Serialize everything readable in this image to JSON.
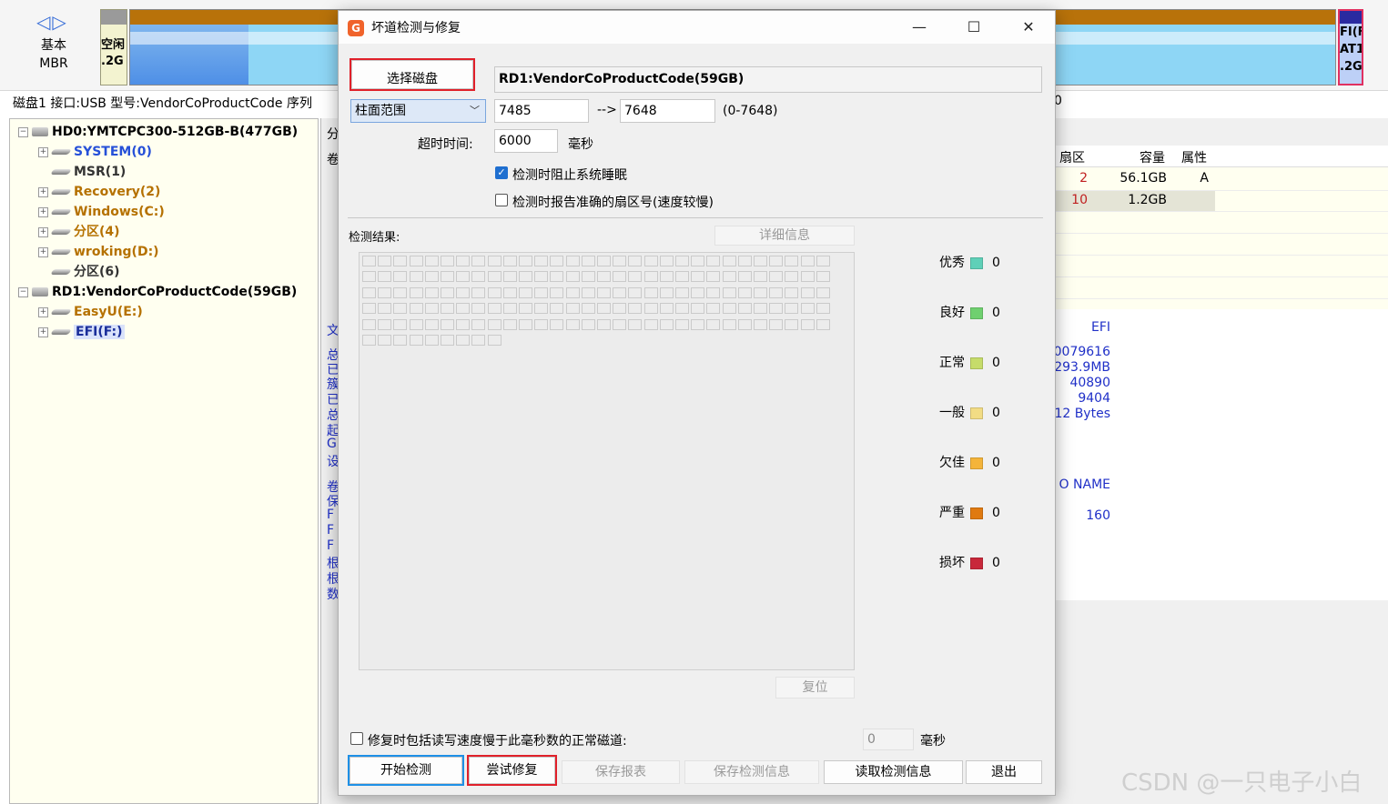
{
  "background": {
    "nav_arrows": "◁▷",
    "disk_type_line1": "基本",
    "disk_type_line2": "MBR",
    "free_block_line1": "空闲",
    "free_block_line2": ".2G",
    "efi_block_line1": "FI(F",
    "efi_block_line2": "AT1",
    "efi_block_line3": ".2G",
    "disk_info_line": "磁盘1 接口:USB  型号:VendorCoProductCode  序列",
    "disk_info_tail": "0",
    "tree": [
      {
        "label": "HD0:YMTCPC300-512GB-B(477GB)",
        "kind": "disk",
        "color": "disk"
      },
      {
        "label": "SYSTEM(0)",
        "kind": "part",
        "color": "blue",
        "expand": "+"
      },
      {
        "label": "MSR(1)",
        "kind": "part",
        "color": "gray",
        "expand": ""
      },
      {
        "label": "Recovery(2)",
        "kind": "part",
        "color": "orange",
        "expand": "+"
      },
      {
        "label": "Windows(C:)",
        "kind": "part",
        "color": "orange",
        "expand": "+"
      },
      {
        "label": "分区(4)",
        "kind": "part",
        "color": "orange",
        "expand": "+"
      },
      {
        "label": "wroking(D:)",
        "kind": "part",
        "color": "orange",
        "expand": "+"
      },
      {
        "label": "分区(6)",
        "kind": "part",
        "color": "gray",
        "expand": ""
      },
      {
        "label": "RD1:VendorCoProductCode(59GB)",
        "kind": "disk",
        "color": "disk"
      },
      {
        "label": "EasyU(E:)",
        "kind": "part",
        "color": "orange",
        "expand": "+"
      },
      {
        "label": "EFI(F:)",
        "kind": "part",
        "color": "sel",
        "expand": "+"
      }
    ],
    "right_partial_labels": [
      "分",
      "卷",
      "文",
      "总",
      "已",
      "簇",
      "已",
      "总",
      "起",
      "G",
      "设",
      "卷",
      "保",
      "F",
      "F",
      "F",
      "根",
      "根",
      "数"
    ],
    "table_headers": {
      "sector": "扇区",
      "capacity": "容量",
      "attr": "属性"
    },
    "table_rows": [
      {
        "sector": "2",
        "capacity": "56.1GB",
        "attr": "A"
      },
      {
        "sector": "10",
        "capacity": "1.2GB",
        "attr": ""
      }
    ],
    "info_values": [
      "EFI",
      "0079616",
      "293.9MB",
      "40890",
      "9404",
      "12 Bytes",
      "O NAME",
      "160"
    ],
    "watermark": "CSDN @一只电子小白"
  },
  "dialog": {
    "title": "坏道检测与修复",
    "app_icon": "G",
    "select_disk_label": "选择磁盘",
    "disk_name": "RD1:VendorCoProductCode(59GB)",
    "range_mode": "柱面范围",
    "range_start": "7485",
    "range_arrow": "-->",
    "range_end": "7648",
    "range_hint": "(0-7648)",
    "timeout_label": "超时时间:",
    "timeout_value": "6000",
    "timeout_unit": "毫秒",
    "opt_prevent_sleep": "检测时阻止系统睡眠",
    "opt_prevent_sleep_checked": true,
    "opt_report_sector": "检测时报告准确的扇区号(速度较慢)",
    "opt_report_sector_checked": false,
    "results_label": "检测结果:",
    "detail_button": "详细信息",
    "reset_button": "复位",
    "legend": [
      {
        "label": "优秀",
        "color": "#5fd0b8",
        "count": "0"
      },
      {
        "label": "良好",
        "color": "#6fd06f",
        "count": "0"
      },
      {
        "label": "正常",
        "color": "#c6dc6a",
        "count": "0"
      },
      {
        "label": "一般",
        "color": "#f2dc84",
        "count": "0"
      },
      {
        "label": "欠佳",
        "color": "#f4b43a",
        "count": "0"
      },
      {
        "label": "严重",
        "color": "#e07a10",
        "count": "0"
      },
      {
        "label": "损坏",
        "color": "#c8283a",
        "count": "0"
      }
    ],
    "repair_slow_label": "修复时包括读写速度慢于此毫秒数的正常磁道:",
    "repair_slow_checked": false,
    "repair_slow_value": "0",
    "repair_slow_unit": "毫秒",
    "buttons": {
      "start": "开始检测",
      "repair": "尝试修复",
      "save_report": "保存报表",
      "save_info": "保存检测信息",
      "load_info": "读取检测信息",
      "exit": "退出"
    },
    "window_controls": {
      "minimize": "—",
      "maximize": "☐",
      "close": "✕"
    }
  }
}
